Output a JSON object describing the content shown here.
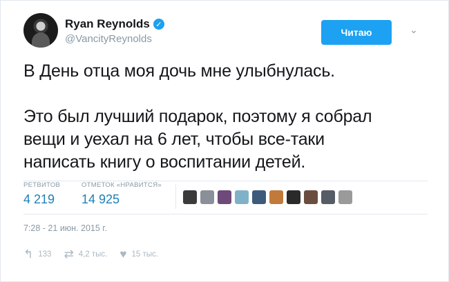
{
  "user": {
    "name": "Ryan Reynolds",
    "handle": "@VancityReynolds",
    "verified_glyph": "✓",
    "avatar_icon": "avatar"
  },
  "follow_button": {
    "label": "Читаю",
    "color": "#1da1f2"
  },
  "menu": {
    "chevron_glyph": "⌄"
  },
  "tweet": {
    "text": "В День отца моя дочь мне улыбнулась.\n\nЭто был лучший подарок, поэтому я собрал\nвещи и уехал на 6 лет, чтобы все-таки\nнаписать книгу о воспитании детей."
  },
  "stats": {
    "retweets_label": "РЕТВИТОВ",
    "retweets_value": "4 219",
    "likes_label": "ОТМЕТОК «НРАВИТСЯ»",
    "likes_value": "14 925",
    "accent": "#1d7fb8"
  },
  "likers": [
    {
      "color": "#3b3b3b"
    },
    {
      "color": "#8a8f99"
    },
    {
      "color": "#6d4a7a"
    },
    {
      "color": "#7fb2c9"
    },
    {
      "color": "#3d5a7d"
    },
    {
      "color": "#c27a3a"
    },
    {
      "color": "#2a2a2a"
    },
    {
      "color": "#6b4d3f"
    },
    {
      "color": "#555c66"
    },
    {
      "color": "#9a9a9a"
    }
  ],
  "timestamp": "7:28 - 21 июн. 2015 г.",
  "actions": {
    "reply_icon": "reply-icon",
    "reply_glyph": "↰",
    "reply_count": "133",
    "retweet_icon": "retweet-icon",
    "retweet_glyph": "⇄",
    "retweet_count": "4,2 тыс.",
    "like_icon": "heart-icon",
    "like_glyph": "♥",
    "like_count": "15 тыс."
  }
}
